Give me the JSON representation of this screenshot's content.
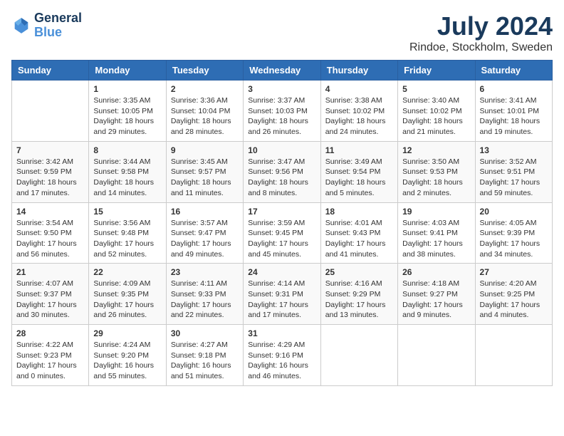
{
  "header": {
    "logo": {
      "line1": "General",
      "line2": "Blue"
    },
    "title": "July 2024",
    "location": "Rindoe, Stockholm, Sweden"
  },
  "days_of_week": [
    "Sunday",
    "Monday",
    "Tuesday",
    "Wednesday",
    "Thursday",
    "Friday",
    "Saturday"
  ],
  "weeks": [
    [
      {
        "day": null,
        "sunrise": null,
        "sunset": null,
        "daylight": null
      },
      {
        "day": "1",
        "sunrise": "Sunrise: 3:35 AM",
        "sunset": "Sunset: 10:05 PM",
        "daylight": "Daylight: 18 hours and 29 minutes."
      },
      {
        "day": "2",
        "sunrise": "Sunrise: 3:36 AM",
        "sunset": "Sunset: 10:04 PM",
        "daylight": "Daylight: 18 hours and 28 minutes."
      },
      {
        "day": "3",
        "sunrise": "Sunrise: 3:37 AM",
        "sunset": "Sunset: 10:03 PM",
        "daylight": "Daylight: 18 hours and 26 minutes."
      },
      {
        "day": "4",
        "sunrise": "Sunrise: 3:38 AM",
        "sunset": "Sunset: 10:02 PM",
        "daylight": "Daylight: 18 hours and 24 minutes."
      },
      {
        "day": "5",
        "sunrise": "Sunrise: 3:40 AM",
        "sunset": "Sunset: 10:02 PM",
        "daylight": "Daylight: 18 hours and 21 minutes."
      },
      {
        "day": "6",
        "sunrise": "Sunrise: 3:41 AM",
        "sunset": "Sunset: 10:01 PM",
        "daylight": "Daylight: 18 hours and 19 minutes."
      }
    ],
    [
      {
        "day": "7",
        "sunrise": "Sunrise: 3:42 AM",
        "sunset": "Sunset: 9:59 PM",
        "daylight": "Daylight: 18 hours and 17 minutes."
      },
      {
        "day": "8",
        "sunrise": "Sunrise: 3:44 AM",
        "sunset": "Sunset: 9:58 PM",
        "daylight": "Daylight: 18 hours and 14 minutes."
      },
      {
        "day": "9",
        "sunrise": "Sunrise: 3:45 AM",
        "sunset": "Sunset: 9:57 PM",
        "daylight": "Daylight: 18 hours and 11 minutes."
      },
      {
        "day": "10",
        "sunrise": "Sunrise: 3:47 AM",
        "sunset": "Sunset: 9:56 PM",
        "daylight": "Daylight: 18 hours and 8 minutes."
      },
      {
        "day": "11",
        "sunrise": "Sunrise: 3:49 AM",
        "sunset": "Sunset: 9:54 PM",
        "daylight": "Daylight: 18 hours and 5 minutes."
      },
      {
        "day": "12",
        "sunrise": "Sunrise: 3:50 AM",
        "sunset": "Sunset: 9:53 PM",
        "daylight": "Daylight: 18 hours and 2 minutes."
      },
      {
        "day": "13",
        "sunrise": "Sunrise: 3:52 AM",
        "sunset": "Sunset: 9:51 PM",
        "daylight": "Daylight: 17 hours and 59 minutes."
      }
    ],
    [
      {
        "day": "14",
        "sunrise": "Sunrise: 3:54 AM",
        "sunset": "Sunset: 9:50 PM",
        "daylight": "Daylight: 17 hours and 56 minutes."
      },
      {
        "day": "15",
        "sunrise": "Sunrise: 3:56 AM",
        "sunset": "Sunset: 9:48 PM",
        "daylight": "Daylight: 17 hours and 52 minutes."
      },
      {
        "day": "16",
        "sunrise": "Sunrise: 3:57 AM",
        "sunset": "Sunset: 9:47 PM",
        "daylight": "Daylight: 17 hours and 49 minutes."
      },
      {
        "day": "17",
        "sunrise": "Sunrise: 3:59 AM",
        "sunset": "Sunset: 9:45 PM",
        "daylight": "Daylight: 17 hours and 45 minutes."
      },
      {
        "day": "18",
        "sunrise": "Sunrise: 4:01 AM",
        "sunset": "Sunset: 9:43 PM",
        "daylight": "Daylight: 17 hours and 41 minutes."
      },
      {
        "day": "19",
        "sunrise": "Sunrise: 4:03 AM",
        "sunset": "Sunset: 9:41 PM",
        "daylight": "Daylight: 17 hours and 38 minutes."
      },
      {
        "day": "20",
        "sunrise": "Sunrise: 4:05 AM",
        "sunset": "Sunset: 9:39 PM",
        "daylight": "Daylight: 17 hours and 34 minutes."
      }
    ],
    [
      {
        "day": "21",
        "sunrise": "Sunrise: 4:07 AM",
        "sunset": "Sunset: 9:37 PM",
        "daylight": "Daylight: 17 hours and 30 minutes."
      },
      {
        "day": "22",
        "sunrise": "Sunrise: 4:09 AM",
        "sunset": "Sunset: 9:35 PM",
        "daylight": "Daylight: 17 hours and 26 minutes."
      },
      {
        "day": "23",
        "sunrise": "Sunrise: 4:11 AM",
        "sunset": "Sunset: 9:33 PM",
        "daylight": "Daylight: 17 hours and 22 minutes."
      },
      {
        "day": "24",
        "sunrise": "Sunrise: 4:14 AM",
        "sunset": "Sunset: 9:31 PM",
        "daylight": "Daylight: 17 hours and 17 minutes."
      },
      {
        "day": "25",
        "sunrise": "Sunrise: 4:16 AM",
        "sunset": "Sunset: 9:29 PM",
        "daylight": "Daylight: 17 hours and 13 minutes."
      },
      {
        "day": "26",
        "sunrise": "Sunrise: 4:18 AM",
        "sunset": "Sunset: 9:27 PM",
        "daylight": "Daylight: 17 hours and 9 minutes."
      },
      {
        "day": "27",
        "sunrise": "Sunrise: 4:20 AM",
        "sunset": "Sunset: 9:25 PM",
        "daylight": "Daylight: 17 hours and 4 minutes."
      }
    ],
    [
      {
        "day": "28",
        "sunrise": "Sunrise: 4:22 AM",
        "sunset": "Sunset: 9:23 PM",
        "daylight": "Daylight: 17 hours and 0 minutes."
      },
      {
        "day": "29",
        "sunrise": "Sunrise: 4:24 AM",
        "sunset": "Sunset: 9:20 PM",
        "daylight": "Daylight: 16 hours and 55 minutes."
      },
      {
        "day": "30",
        "sunrise": "Sunrise: 4:27 AM",
        "sunset": "Sunset: 9:18 PM",
        "daylight": "Daylight: 16 hours and 51 minutes."
      },
      {
        "day": "31",
        "sunrise": "Sunrise: 4:29 AM",
        "sunset": "Sunset: 9:16 PM",
        "daylight": "Daylight: 16 hours and 46 minutes."
      },
      {
        "day": null,
        "sunrise": null,
        "sunset": null,
        "daylight": null
      },
      {
        "day": null,
        "sunrise": null,
        "sunset": null,
        "daylight": null
      },
      {
        "day": null,
        "sunrise": null,
        "sunset": null,
        "daylight": null
      }
    ]
  ]
}
